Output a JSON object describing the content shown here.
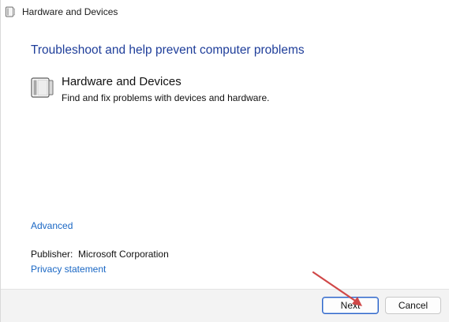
{
  "window": {
    "title": "Hardware and Devices",
    "title_icon": "troubleshooter-icon"
  },
  "main": {
    "heading": "Troubleshoot and help prevent computer problems",
    "item": {
      "icon": "hardware-devices-icon",
      "title": "Hardware and Devices",
      "description": "Find and fix problems with devices and hardware."
    },
    "advanced_link": "Advanced",
    "publisher_label": "Publisher:",
    "publisher_value": "Microsoft Corporation",
    "privacy_link": "Privacy statement"
  },
  "footer": {
    "next_label": "Next",
    "cancel_label": "Cancel"
  },
  "colors": {
    "heading": "#1f3e9a",
    "link": "#1a67c4",
    "annotation_arrow": "#d04848"
  }
}
